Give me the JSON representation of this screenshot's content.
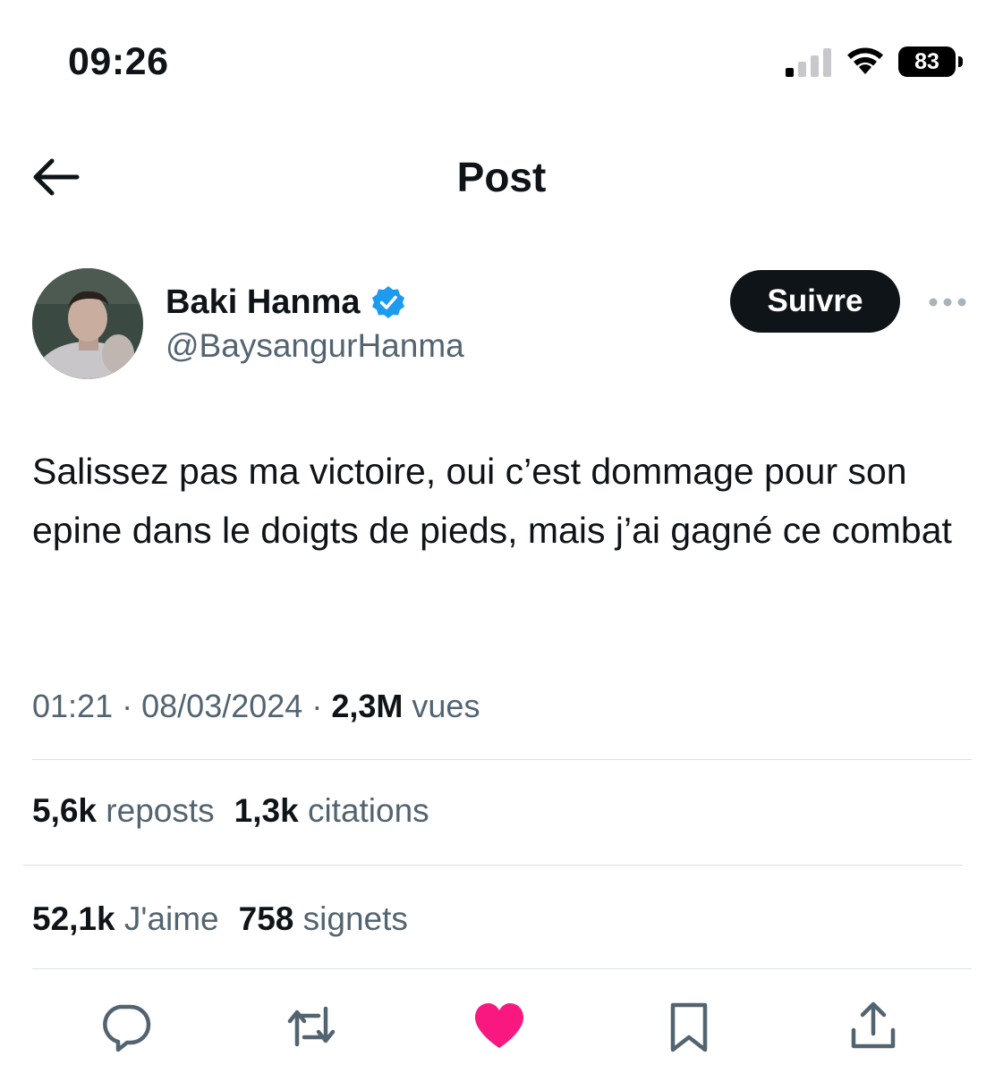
{
  "status_bar": {
    "time": "09:26",
    "battery": "83"
  },
  "header": {
    "title": "Post"
  },
  "author": {
    "name": "Baki Hanma",
    "handle": "@BaysangurHanma",
    "verified": true
  },
  "actions": {
    "follow_label": "Suivre"
  },
  "tweet": {
    "text": "Salissez pas ma victoire, oui c’est dommage pour son epine dans le doigts de pieds, mais j’ai gagné ce combat",
    "time": "01:21",
    "separator": "·",
    "date": "08/03/2024",
    "views_count": "2,3M",
    "views_label": "vues"
  },
  "stats": {
    "reposts_count": "5,6k",
    "reposts_label": "reposts",
    "quotes_count": "1,3k",
    "quotes_label": "citations",
    "likes_count": "52,1k",
    "likes_label": "J'aime",
    "bookmarks_count": "758",
    "bookmarks_label": "signets"
  },
  "icons": {
    "back": "arrow-left-icon",
    "more": "more-horizontal-icon",
    "verified": "verified-badge-icon",
    "reply": "reply-icon",
    "repost": "repost-icon",
    "like": "heart-icon",
    "bookmark": "bookmark-icon",
    "share": "share-icon"
  },
  "colors": {
    "accent_blue": "#1d9bf0",
    "like_pink": "#f91880",
    "text_primary": "#0f1419",
    "text_secondary": "#536471",
    "follow_bg": "#0f1419"
  }
}
